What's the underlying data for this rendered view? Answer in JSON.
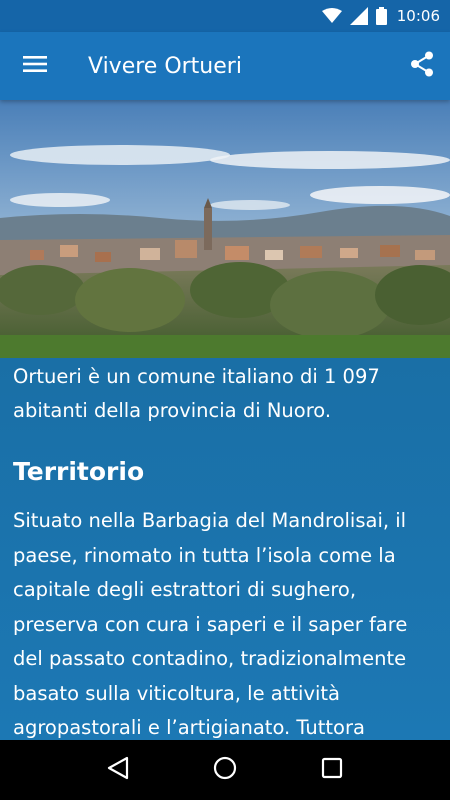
{
  "status_bar": {
    "time": "10:06",
    "icons": [
      "wifi-icon",
      "signal-icon",
      "battery-icon"
    ]
  },
  "app_bar": {
    "title": "Vivere Ortueri",
    "menu_icon": "menu-icon",
    "share_icon": "share-icon"
  },
  "hero": {
    "image_desc": "panoramic-village-photo"
  },
  "content": {
    "intro": "Ortueri è un comune italiano di 1 097 abitanti della provincia di Nuoro.",
    "section_title": "Territorio",
    "body": "Situato nella Barbagia del Mandrolisai, il paese, rinomato in tutta l’isola come la capitale degli estrattori di sughero, preserva con cura i saperi e il saper fare del passato contadino, tradizionalmente basato sulla viticoltura, le attività agropastorali e l’artigianato. Tuttora presenta un ricco"
  },
  "nav_bar": {
    "back_icon": "back-icon",
    "home_icon": "home-icon",
    "recents_icon": "recents-icon"
  },
  "colors": {
    "status_bar": "#1565a8",
    "app_bar": "#1b75bc",
    "content_bg": "#1a6fa6",
    "nav_bar": "#000000"
  }
}
